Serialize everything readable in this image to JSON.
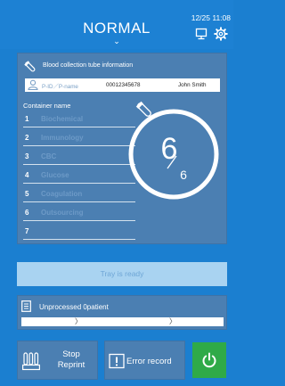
{
  "header": {
    "mode": "NORMAL",
    "clock": "12/25 11:08"
  },
  "info_panel": {
    "title": "Blood collection tube information",
    "patient": {
      "id_label": "P-ID／P-name",
      "id_value": "00012345678",
      "name_value": "John Smith"
    },
    "container_title": "Container name",
    "containers": [
      {
        "num": "1",
        "name": "Biochemical"
      },
      {
        "num": "2",
        "name": "Immunology"
      },
      {
        "num": "3",
        "name": "CBC"
      },
      {
        "num": "4",
        "name": "Glucose"
      },
      {
        "num": "5",
        "name": "Coagulation"
      },
      {
        "num": "6",
        "name": "Outsourcing"
      },
      {
        "num": "7",
        "name": ""
      }
    ],
    "dial": {
      "current": "6",
      "total": "6"
    }
  },
  "tray_status": "Tray is ready",
  "unprocessed": {
    "label": "Unprocessed 0patient",
    "marks": [
      "〉",
      "〉"
    ]
  },
  "buttons": {
    "stop_line1": "Stop",
    "stop_line2": "Reprint",
    "error": "Error record"
  },
  "colors": {
    "background": "#1b7fd0",
    "panel": "#4b7fb2",
    "accent_text": "#6d9ac7",
    "tray_bar": "#a9d3f1",
    "power": "#2faa48"
  },
  "icons": [
    "monitor-icon",
    "gear-icon",
    "test-tube-icon",
    "user-icon",
    "document-icon",
    "tube-rack-icon",
    "error-icon",
    "power-icon"
  ]
}
